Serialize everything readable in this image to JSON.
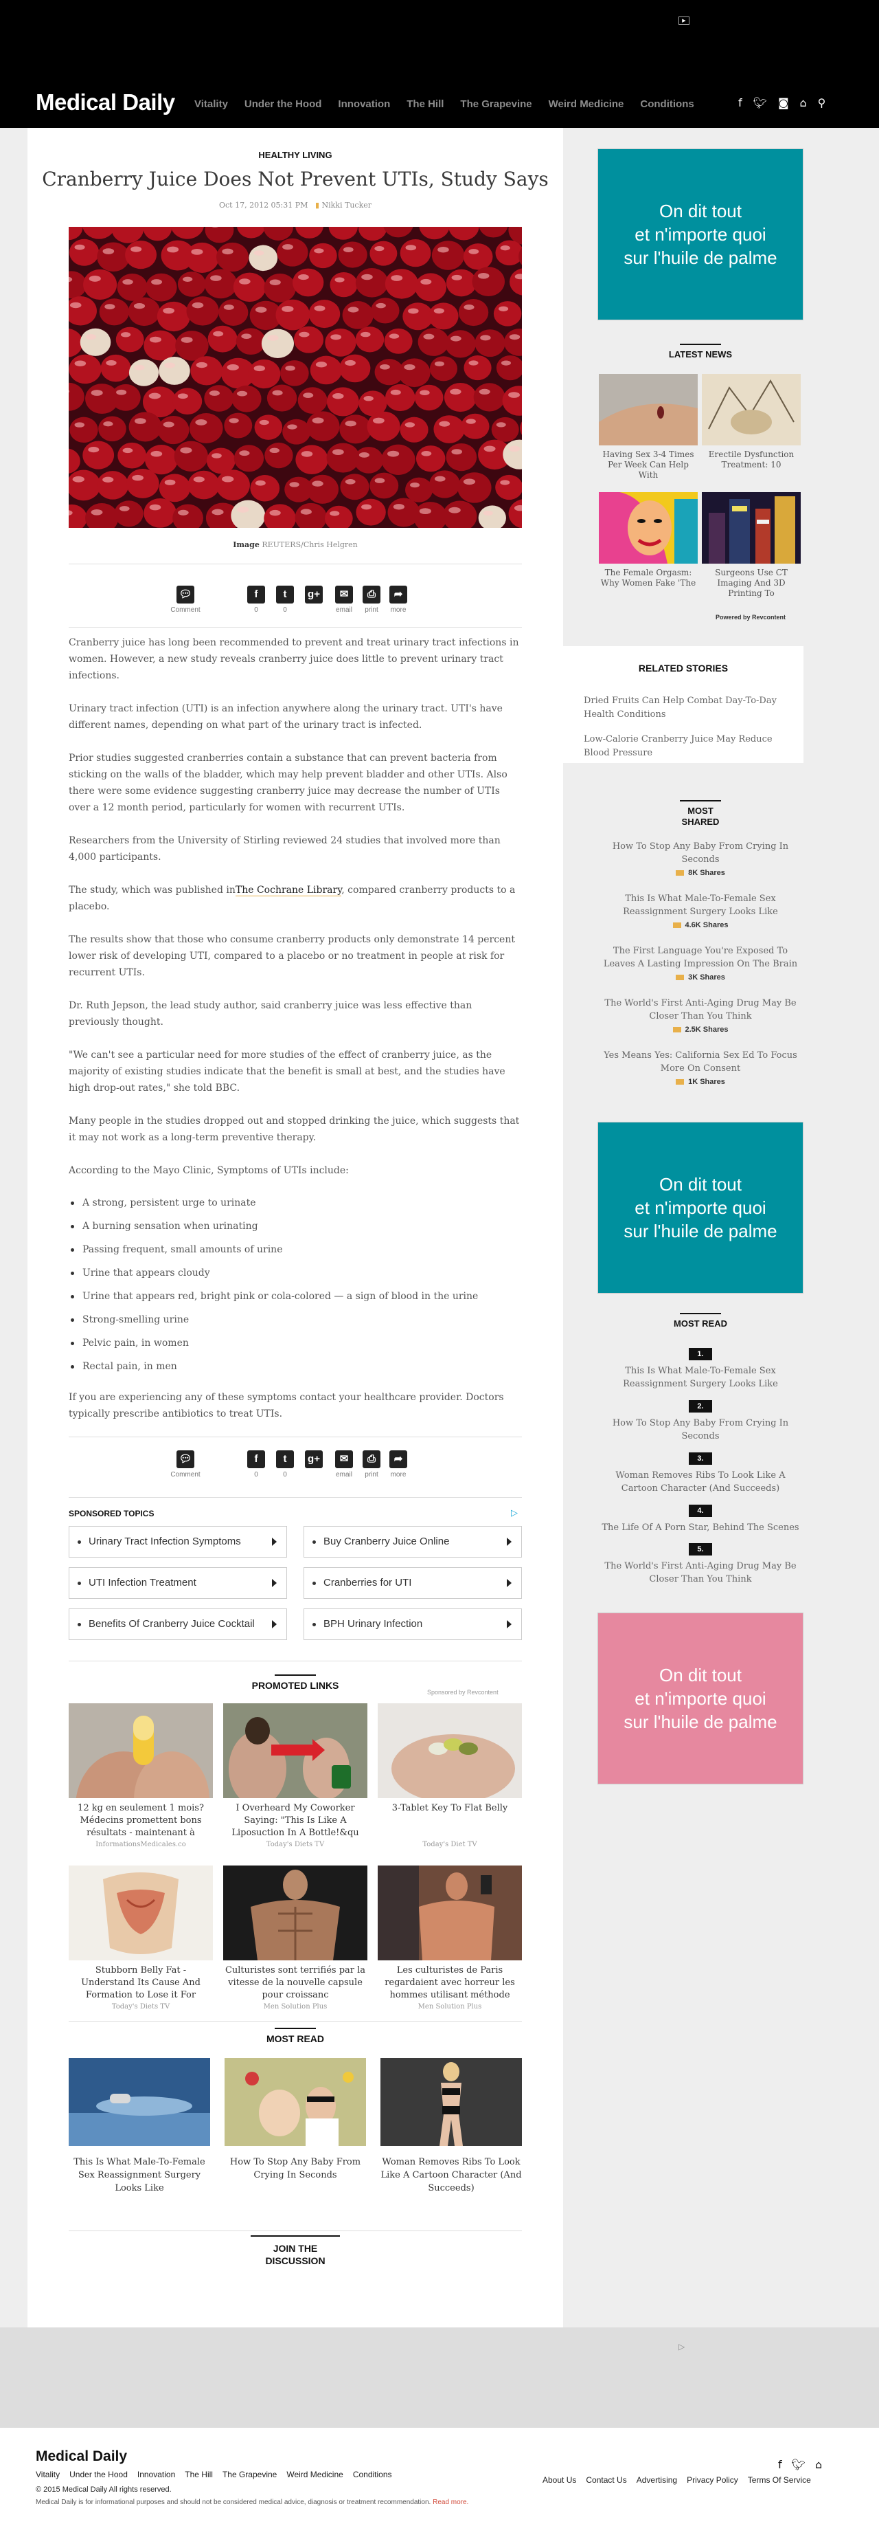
{
  "header": {
    "logo": "Medical Daily",
    "nav": [
      "Vitality",
      "Under the Hood",
      "Innovation",
      "The Hill",
      "The Grapevine",
      "Weird Medicine",
      "Conditions"
    ],
    "social_icons": [
      "facebook-icon",
      "twitter-icon",
      "instagram-icon",
      "home-icon",
      "search-icon"
    ]
  },
  "article": {
    "category": "HEALTHY LIVING",
    "title": "Cranberry Juice Does Not Prevent UTIs, Study Says",
    "date": "Oct 17, 2012 05:31 PM",
    "author": "Nikki Tucker",
    "caption_label": "Image",
    "caption_credit": "REUTERS/Chris Helgren",
    "share": {
      "comment": "Comment",
      "facebook_count": "0",
      "twitter_count": "0",
      "email": "email",
      "print": "print",
      "more": "more"
    },
    "paragraphs": [
      "Cranberry juice has long been recommended to prevent and treat urinary tract infections in women. However, a new study reveals cranberry juice does little to prevent urinary tract infections.",
      "Urinary tract infection (UTI) is an infection anywhere along the urinary tract. UTI's have different names, depending on what part of the urinary tract is infected.",
      "Prior studies suggested cranberries contain a substance that can prevent bacteria from sticking on the walls of the bladder, which may help prevent bladder and other UTIs. Also there were some evidence suggesting cranberry juice may decrease the number of UTIs over a 12 month period, particularly for women with recurrent UTIs.",
      "Researchers from the University of Stirling reviewed 24 studies that involved more than 4,000 participants.",
      "The study, which was published in",
      "The results show that those who consume cranberry products only demonstrate 14 percent lower risk of developing UTI, compared to a placebo or no treatment in people at risk for recurrent UTIs.",
      "Dr. Ruth Jepson, the lead study author, said cranberry juice was less effective than previously thought.",
      "\"We can't see a particular need for more studies of the effect of cranberry juice, as the majority of existing studies indicate that the benefit is small at best, and the studies have high drop-out rates,\" she told BBC.",
      "Many people in the studies dropped out and stopped drinking the juice, which suggests that it may not work as a long-term preventive therapy.",
      "According to the Mayo Clinic, Symptoms of UTIs include:",
      "If you are experiencing any of these symptoms contact your healthcare provider. Doctors typically prescribe antibiotics to treat UTIs."
    ],
    "study_link": "The Cochrane Library",
    "study_after": ", compared cranberry products to a placebo.",
    "symptoms": [
      "A strong, persistent urge to urinate",
      "A burning sensation when urinating",
      "Passing frequent, small amounts of urine",
      "Urine that appears cloudy",
      "Urine that appears red, bright pink or cola-colored — a sign of blood in the urine",
      "Strong-smelling urine",
      "Pelvic pain, in women",
      "Rectal pain, in men"
    ]
  },
  "sponsored": {
    "label": "SPONSORED TOPICS",
    "items": [
      "Urinary Tract Infection Symptoms",
      "Buy Cranberry Juice Online",
      "UTI Infection Treatment",
      "Cranberries for UTI",
      "Benefits Of Cranberry Juice Cocktail",
      "BPH Urinary Infection"
    ]
  },
  "promoted": {
    "label": "PROMOTED LINKS",
    "sponsored_by": "Sponsored by Revcontent",
    "items": [
      {
        "title": "12 kg en seulement 1 mois? Médecins promettent bons résultats - maintenant à",
        "source": "InformationsMedicales.co"
      },
      {
        "title": "I Overheard My Coworker Saying: \"This Is Like A Liposuction In A Bottle!&qu",
        "source": "Today's Diets TV"
      },
      {
        "title": "3-Tablet Key To Flat Belly",
        "source": "Today's Diet TV"
      },
      {
        "title": "Stubborn Belly Fat - Understand Its Cause And Formation to Lose it For",
        "source": "Today's Diets TV"
      },
      {
        "title": "Culturistes sont terrifiés par la vitesse de la nouvelle capsule pour croissanc",
        "source": "Men Solution Plus"
      },
      {
        "title": "Les culturistes de Paris regardaient avec horreur les hommes utilisant méthode",
        "source": "Men Solution Plus"
      }
    ]
  },
  "most_read_bottom": {
    "label": "MOST READ",
    "items": [
      "This Is What Male-To-Female Sex Reassignment Surgery Looks Like",
      "How To Stop Any Baby From Crying In Seconds",
      "Woman Removes Ribs To Look Like A Cartoon Character (And Succeeds)"
    ]
  },
  "join": [
    "JOIN THE",
    "DISCUSSION"
  ],
  "sidebar": {
    "ad_text": [
      "On dit tout",
      "et n'importe quoi",
      "sur l'huile de palme"
    ],
    "latest_label": "LATEST NEWS",
    "latest": [
      "Having Sex 3-4 Times Per Week Can Help With",
      "Erectile Dysfunction Treatment: 10",
      "The Female Orgasm: Why Women Fake 'The",
      "Surgeons Use CT Imaging And 3D Printing To"
    ],
    "powered_by": "Powered by Revcontent",
    "related_label": "RELATED STORIES",
    "related": [
      "Dried Fruits Can Help Combat Day-To-Day Health Conditions",
      "Low-Calorie Cranberry Juice May Reduce Blood Pressure"
    ],
    "most_shared_label": [
      "MOST",
      "SHARED"
    ],
    "most_shared": [
      {
        "title": "How To Stop Any Baby From Crying In Seconds",
        "shares": "8K Shares"
      },
      {
        "title": "This Is What Male-To-Female Sex Reassignment Surgery Looks Like",
        "shares": "4.6K Shares"
      },
      {
        "title": "The First Language You're Exposed To Leaves A Lasting Impression On The Brain",
        "shares": "3K Shares"
      },
      {
        "title": "The World's First Anti-Aging Drug May Be Closer Than You Think",
        "shares": "2.5K Shares"
      },
      {
        "title": "Yes Means Yes: California Sex Ed To Focus More On Consent",
        "shares": "1K Shares"
      }
    ],
    "most_read_label": "MOST READ",
    "most_read": [
      {
        "num": "1.",
        "title": "This Is What Male-To-Female Sex Reassignment Surgery Looks Like"
      },
      {
        "num": "2.",
        "title": "How To Stop Any Baby From Crying In Seconds"
      },
      {
        "num": "3.",
        "title": "Woman Removes Ribs To Look Like A Cartoon Character (And Succeeds)"
      },
      {
        "num": "4.",
        "title": "The Life Of A Porn Star, Behind The Scenes"
      },
      {
        "num": "5.",
        "title": "The World's First Anti-Aging Drug May Be Closer Than You Think"
      }
    ]
  },
  "footer": {
    "logo": "Medical Daily",
    "nav": [
      "Vitality",
      "Under the Hood",
      "Innovation",
      "The Hill",
      "The Grapevine",
      "Weird Medicine",
      "Conditions"
    ],
    "copyright": "© 2015 Medical Daily All rights reserved.",
    "disclaimer": "Medical Daily is for informational purposes and should not be considered medical advice, diagnosis or treatment recommendation.",
    "read_more": "Read more.",
    "links": [
      "About Us",
      "Contact Us",
      "Advertising",
      "Privacy Policy",
      "Terms Of Service"
    ]
  }
}
